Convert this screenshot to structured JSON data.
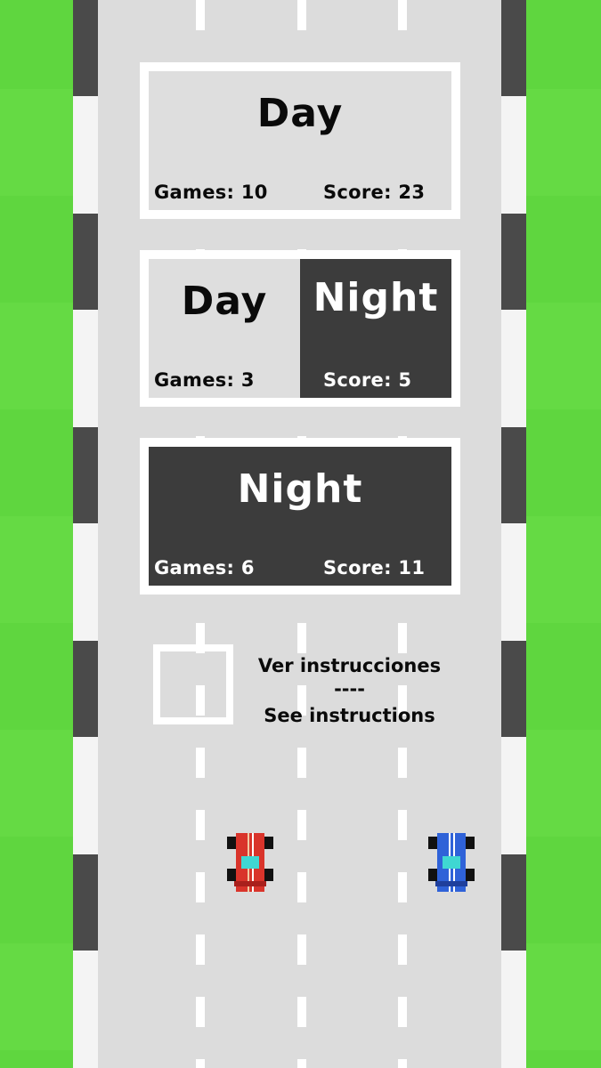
{
  "modes": {
    "day": {
      "title": "Day",
      "games_label": "Games: 10",
      "score_label": "Score: 23"
    },
    "mixed": {
      "day_title": "Day",
      "night_title": "Night",
      "games_label": "Games: 3",
      "score_label": "Score: 5"
    },
    "night": {
      "title": "Night",
      "games_label": "Games: 6",
      "score_label": "Score: 11"
    }
  },
  "instructions": {
    "line1": "Ver instrucciones",
    "separator": "----",
    "line2": "See instructions"
  },
  "cars": {
    "player1_color": "#d9342b",
    "player2_color": "#2f62d8"
  },
  "colors": {
    "grass": "#5fd63f",
    "road": "#dcdcdc",
    "dark_panel": "#3c3c3c"
  }
}
